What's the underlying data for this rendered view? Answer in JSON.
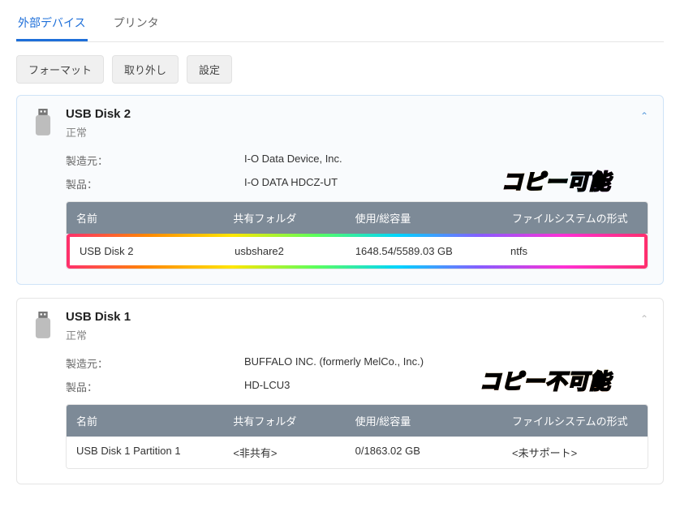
{
  "tabs": {
    "external": "外部デバイス",
    "printer": "プリンタ"
  },
  "toolbar": {
    "format": "フォーマット",
    "eject": "取り外し",
    "settings": "設定"
  },
  "labels": {
    "manufacturer": "製造元：",
    "product": "製品：",
    "col_name": "名前",
    "col_share": "共有フォルダ",
    "col_usage": "使用/総容量",
    "col_fs": "ファイルシステムの形式"
  },
  "annotations": {
    "ok": "コピー可能",
    "ng": "コピー不可能"
  },
  "disks": [
    {
      "name": "USB Disk 2",
      "status": "正常",
      "manufacturer": "I-O Data Device, Inc.",
      "product": "I-O DATA HDCZ-UT",
      "row": {
        "name": "USB Disk 2",
        "share": "usbshare2",
        "usage": "1648.54/5589.03 GB",
        "fs": "ntfs"
      }
    },
    {
      "name": "USB Disk 1",
      "status": "正常",
      "manufacturer": "BUFFALO INC. (formerly MelCo., Inc.)",
      "product": "HD-LCU3",
      "row": {
        "name": "USB Disk 1 Partition 1",
        "share": "<非共有>",
        "usage": "0/1863.02 GB",
        "fs": "<未サポート>"
      }
    }
  ]
}
